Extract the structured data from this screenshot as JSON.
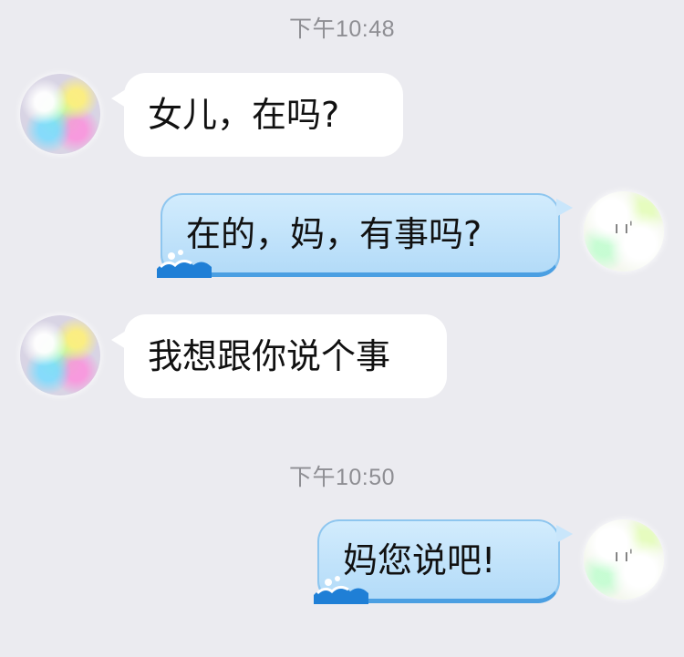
{
  "timestamps": [
    "下午10:48",
    "下午10:50"
  ],
  "messages": [
    {
      "side": "in",
      "text": "女儿，在吗?"
    },
    {
      "side": "out",
      "text": "在的，妈，有事吗?"
    },
    {
      "side": "in",
      "text": "我想跟你说个事"
    },
    {
      "side": "out",
      "text": "妈您说吧!"
    }
  ],
  "avatar_glyphs": {
    "self": "ı ıˈ"
  },
  "colors": {
    "background": "#ebebf0",
    "incoming_bubble": "#ffffff",
    "outgoing_bubble": "#c6e4fa",
    "outgoing_border": "#4b9fe2",
    "timestamp_text": "#8e8e93"
  }
}
